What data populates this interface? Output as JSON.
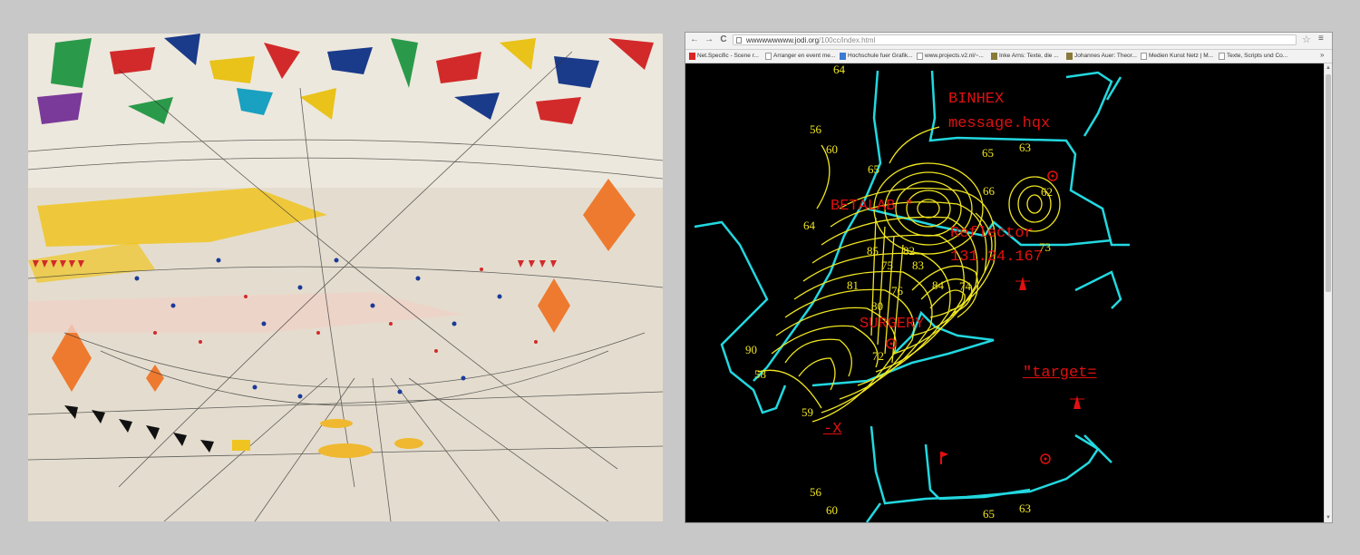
{
  "browser": {
    "url_host": "wwwwwwwww.jodi.org",
    "url_path": "/100cc/index.html",
    "bookmarks": [
      {
        "label": "Net.Specific - Scene r...",
        "icon": "red"
      },
      {
        "label": "Arranger en event me...",
        "icon": "page"
      },
      {
        "label": "Hochschule fuer Grafik...",
        "icon": "blue"
      },
      {
        "label": "www.projects.v2.nl/~...",
        "icon": "page"
      },
      {
        "label": "Inke Arns: Texte, die ...",
        "icon": "olive"
      },
      {
        "label": "Johannes Auer: Theor...",
        "icon": "olive"
      },
      {
        "label": "Medien Kunst Netz | M...",
        "icon": "page"
      },
      {
        "label": "Texte, Scripts und Co...",
        "icon": "page"
      }
    ],
    "bookmarks_more": "»",
    "nav": {
      "back": "←",
      "forward": "→",
      "reload": "C"
    },
    "star": "☆",
    "menu": "≡"
  },
  "map": {
    "labels": {
      "binhex": "BINHEX",
      "message": "message.hqx",
      "betalab": "BETALAB *",
      "reflector": "Reflector",
      "ip": "131.24.167",
      "surgery": "SURGERY",
      "target": "\"target=",
      "x": "-X"
    },
    "numbers": {
      "n64_top": "64",
      "n56_top": "56",
      "n60_top": "60",
      "n65_a": "65",
      "n65_b": "65",
      "n63_top": "63",
      "n62": "62",
      "n66": "66",
      "n64_mid": "64",
      "n85": "85",
      "n75": "75",
      "n83": "83",
      "n82": "82",
      "n73": "73",
      "n81": "81",
      "n76": "76",
      "n80": "80",
      "n74": "74",
      "n84": "84",
      "n90": "90",
      "n58": "58",
      "n72": "72",
      "n59": "59",
      "n56_bot": "56",
      "n60_bot": "60",
      "n65_bot": "65",
      "n63_bot": "63"
    }
  },
  "colors": {
    "map_bg": "#000000",
    "contour": "#f0e620",
    "boundary": "#22d8e0",
    "label_red": "#e01010",
    "page_bg": "#c8c8c8"
  }
}
